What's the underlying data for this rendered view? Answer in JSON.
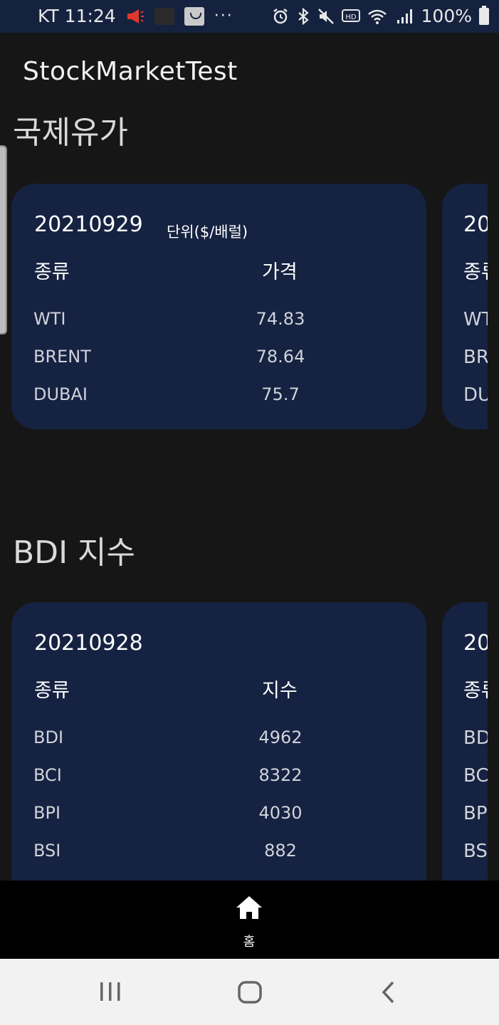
{
  "status_bar": {
    "carrier_time": "KT 11:24",
    "dots": "···",
    "battery": "100%",
    "icons": [
      "megaphone-icon",
      "notification-square-icon",
      "shopping-bag-icon",
      "alarm-icon",
      "bluetooth-icon",
      "mute-icon",
      "hd-icon",
      "wifi-icon",
      "signal-icon",
      "battery-icon"
    ]
  },
  "app": {
    "title": "StockMarketTest"
  },
  "oil": {
    "section_title": "국제유가",
    "date": "20210929",
    "unit": "단위($/배럴)",
    "col_type": "종류",
    "col_value": "가격",
    "rows": [
      {
        "name": "WTI",
        "value": "74.83"
      },
      {
        "name": "BRENT",
        "value": "78.64"
      },
      {
        "name": "DUBAI",
        "value": "75.7"
      }
    ],
    "peek": {
      "date": "20",
      "col_type": "종류",
      "rows": [
        "WT",
        "BR",
        "DUI"
      ]
    }
  },
  "bdi": {
    "section_title": "BDI 지수",
    "date": "20210928",
    "col_type": "종류",
    "col_value": "지수",
    "rows": [
      {
        "name": "BDI",
        "value": "4962"
      },
      {
        "name": "BCI",
        "value": "8322"
      },
      {
        "name": "BPI",
        "value": "4030"
      },
      {
        "name": "BSI",
        "value": "882"
      }
    ],
    "peek": {
      "date": "20",
      "col_type": "종류",
      "rows": [
        "BD",
        "BC",
        "BP",
        "BS"
      ]
    }
  },
  "bottom_nav": {
    "home_label": "홈",
    "home_icon": "home-icon"
  },
  "system_nav": {
    "icons": [
      "recent-apps-icon",
      "home-circle-icon",
      "back-icon"
    ]
  },
  "colors": {
    "background": "#161616",
    "card": "#152241",
    "status_bar": "#15223f",
    "nav": "#000000"
  }
}
